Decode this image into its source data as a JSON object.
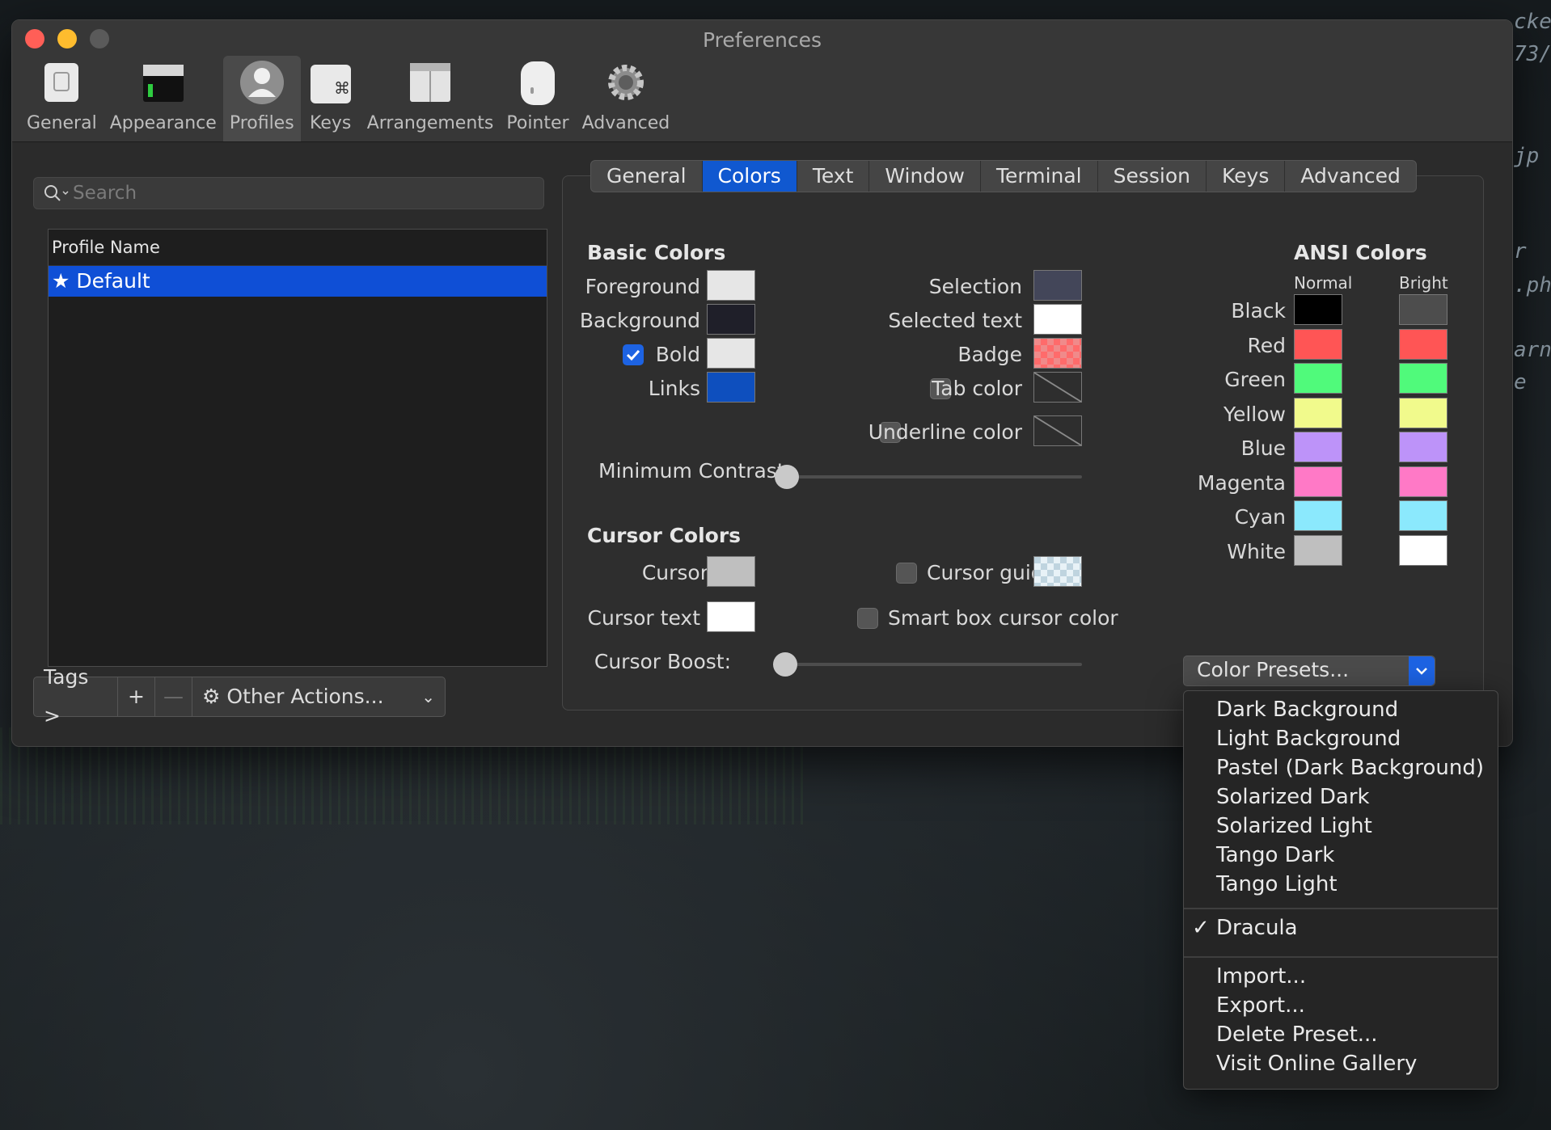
{
  "window": {
    "title": "Preferences"
  },
  "toolbar": {
    "items": [
      {
        "label": "General",
        "icon": "general-icon"
      },
      {
        "label": "Appearance",
        "icon": "appearance-icon"
      },
      {
        "label": "Profiles",
        "icon": "profiles-icon"
      },
      {
        "label": "Keys",
        "icon": "keys-icon"
      },
      {
        "label": "Arrangements",
        "icon": "arrangements-icon"
      },
      {
        "label": "Pointer",
        "icon": "pointer-icon"
      },
      {
        "label": "Advanced",
        "icon": "advanced-icon"
      }
    ],
    "active": "Profiles"
  },
  "profiles": {
    "search_placeholder": "Search",
    "column_header": "Profile Name",
    "rows": [
      {
        "name": "Default",
        "default": true
      }
    ],
    "tags_label": "Tags >",
    "add_label": "+",
    "remove_label": "—",
    "other_actions_label": "Other Actions..."
  },
  "tabs": [
    "General",
    "Colors",
    "Text",
    "Window",
    "Terminal",
    "Session",
    "Keys",
    "Advanced"
  ],
  "active_tab": "Colors",
  "basic_colors": {
    "title": "Basic Colors",
    "foreground": {
      "label": "Foreground",
      "color": "#e6e6e6"
    },
    "background": {
      "label": "Background",
      "color": "#1f1f29"
    },
    "bold": {
      "label": "Bold",
      "color": "#e6e6e6",
      "checked": true
    },
    "links": {
      "label": "Links",
      "color": "#0e4fbe"
    },
    "selection": {
      "label": "Selection",
      "color": "#434659"
    },
    "selected_text": {
      "label": "Selected text",
      "color": "#ffffff"
    },
    "badge": {
      "label": "Badge",
      "color": "#ff5f5f"
    },
    "tab_color": {
      "label": "Tab color",
      "checked": false
    },
    "underline_color": {
      "label": "Underline color",
      "checked": false
    },
    "minimum_contrast": {
      "label": "Minimum Contrast:",
      "value": 0
    }
  },
  "cursor_colors": {
    "title": "Cursor Colors",
    "cursor": {
      "label": "Cursor",
      "color": "#bfbfbf"
    },
    "cursor_text": {
      "label": "Cursor text",
      "color": "#ffffff"
    },
    "cursor_guide": {
      "label": "Cursor guide",
      "checked": false
    },
    "smart_box": {
      "label": "Smart box cursor color",
      "checked": false
    },
    "cursor_boost": {
      "label": "Cursor Boost:",
      "value": 0
    }
  },
  "ansi": {
    "title": "ANSI Colors",
    "normal_header": "Normal",
    "bright_header": "Bright",
    "rows": [
      {
        "name": "Black",
        "normal": "#000000",
        "bright": "#4d4d4d"
      },
      {
        "name": "Red",
        "normal": "#ff5555",
        "bright": "#ff5555"
      },
      {
        "name": "Green",
        "normal": "#50fa7b",
        "bright": "#50fa7b"
      },
      {
        "name": "Yellow",
        "normal": "#f1fa8c",
        "bright": "#f1fa8c"
      },
      {
        "name": "Blue",
        "normal": "#bd93f9",
        "bright": "#bd93f9"
      },
      {
        "name": "Magenta",
        "normal": "#ff79c6",
        "bright": "#ff79c6"
      },
      {
        "name": "Cyan",
        "normal": "#8be9fd",
        "bright": "#8be9fd"
      },
      {
        "name": "White",
        "normal": "#bfbfbf",
        "bright": "#ffffff"
      }
    ]
  },
  "color_presets": {
    "label": "Color Presets...",
    "items_group1": [
      "Dark Background",
      "Light Background",
      "Pastel (Dark Background)",
      "Solarized Dark",
      "Solarized Light",
      "Tango Dark",
      "Tango Light"
    ],
    "checked_item": "Dracula",
    "items_group3": [
      "Import...",
      "Export...",
      "Delete Preset...",
      "Visit Online Gallery"
    ]
  },
  "accent_color": "#1058d0"
}
